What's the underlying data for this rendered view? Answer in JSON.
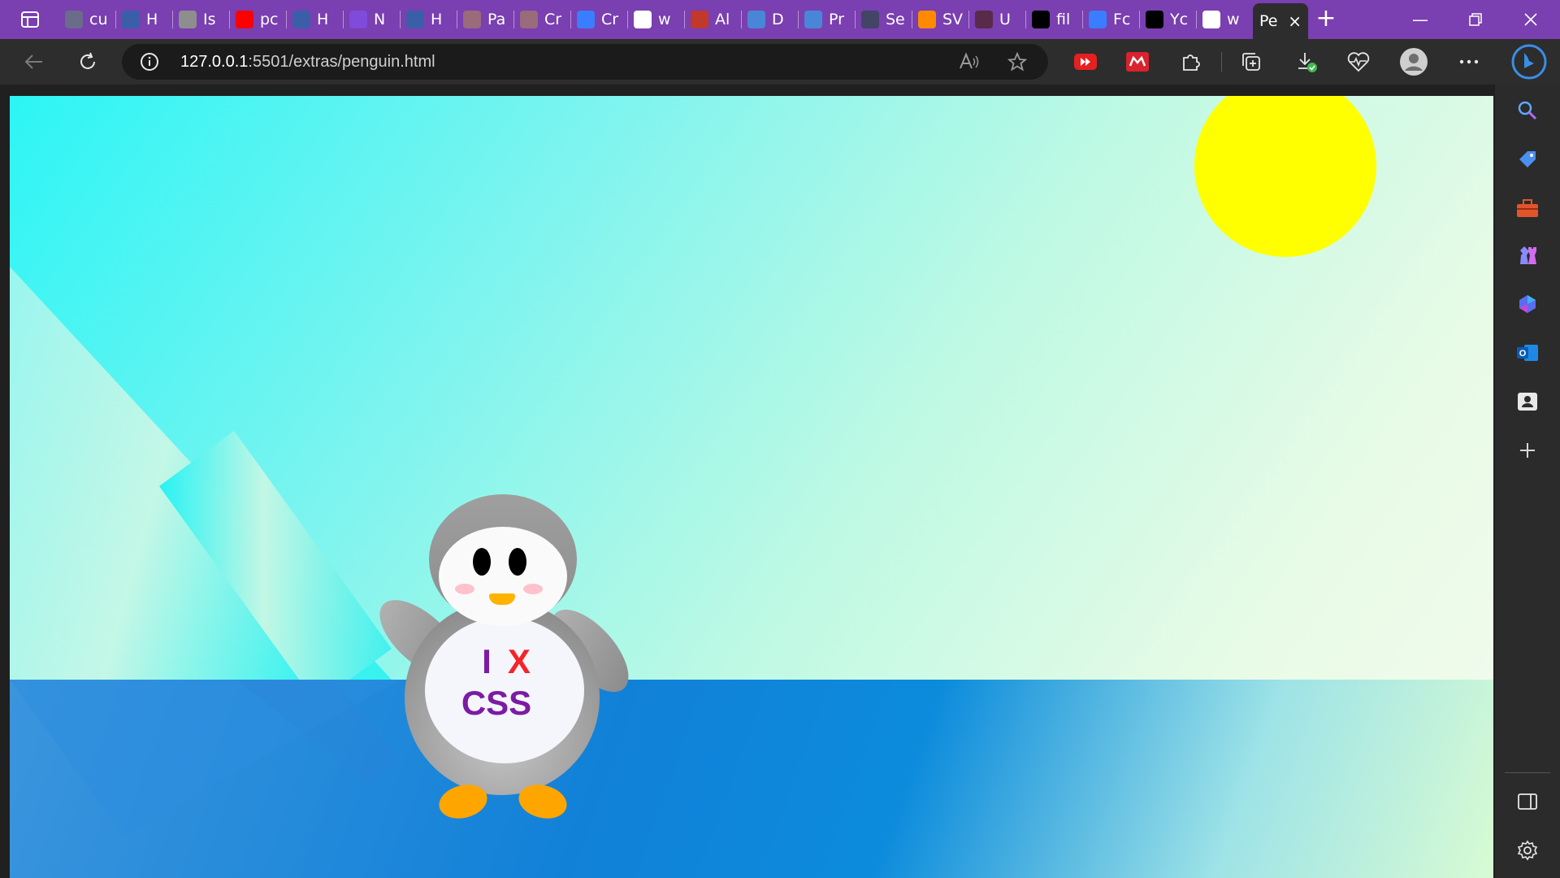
{
  "browser": {
    "url": {
      "host": "127.0.0.1",
      "rest": ":5501/extras/penguin.html"
    },
    "tabs": [
      {
        "label": "cu",
        "icon": "openai-icon",
        "color": "#6b6b8a"
      },
      {
        "label": "H",
        "icon": "w-logo-icon",
        "color": "#3b5ea8"
      },
      {
        "label": "Is",
        "icon": "page-icon",
        "color": "#8e8e8e"
      },
      {
        "label": "pc",
        "icon": "youtube-icon",
        "color": "#ff0000"
      },
      {
        "label": "H",
        "icon": "w-logo-icon",
        "color": "#3b5ea8"
      },
      {
        "label": "N",
        "icon": "bootstrap-icon",
        "color": "#7e4bdb"
      },
      {
        "label": "H",
        "icon": "w-logo-icon",
        "color": "#3b5ea8"
      },
      {
        "label": "Pa",
        "icon": "shield-icon",
        "color": "#9a6b7a"
      },
      {
        "label": "Cr",
        "icon": "shield-icon",
        "color": "#9a6b7a"
      },
      {
        "label": "Cr",
        "icon": "circle-logo-icon",
        "color": "#3a7dff"
      },
      {
        "label": "w",
        "icon": "google-icon",
        "color": "#ffffff"
      },
      {
        "label": "Al",
        "icon": "al-icon",
        "color": "#c0392b"
      },
      {
        "label": "D",
        "icon": "bookmark-icon",
        "color": "#4a86d8"
      },
      {
        "label": "Pr",
        "icon": "bookmark-icon",
        "color": "#4a86d8"
      },
      {
        "label": "Se",
        "icon": "avatar-icon",
        "color": "#444466"
      },
      {
        "label": "SV",
        "icon": "grid-icon",
        "color": "#ff8a00"
      },
      {
        "label": "U",
        "icon": "dot-icon",
        "color": "#5a2a4a"
      },
      {
        "label": "fil",
        "icon": "m-logo-icon",
        "color": "#000000"
      },
      {
        "label": "Fc",
        "icon": "flag-icon",
        "color": "#3a7dff"
      },
      {
        "label": "Yc",
        "icon": "codepen-icon",
        "color": "#000000"
      },
      {
        "label": "w",
        "icon": "google-icon",
        "color": "#ffffff"
      }
    ],
    "active_tab": {
      "label": "Pe"
    }
  },
  "penguin": {
    "line1_i": "I",
    "line1_x": "X",
    "line2": "CSS"
  },
  "colors": {
    "sun": "#ffff00",
    "tabbar": "#7a3fb0",
    "text_purple": "#7b1ca3",
    "text_red": "#f5232a"
  }
}
